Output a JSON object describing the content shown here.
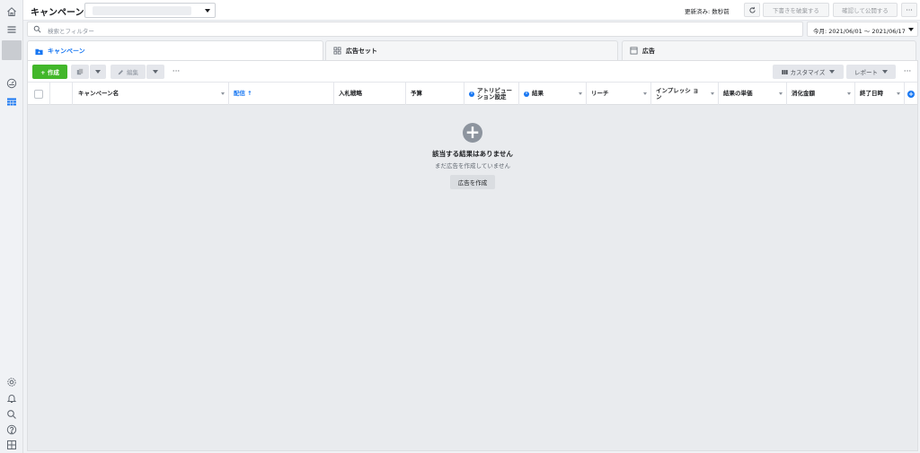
{
  "header": {
    "title": "キャンペーン",
    "updated": "更新済み: 数秒前",
    "discard_label": "下書きを破棄する",
    "publish_label": "確認して公開する",
    "more": "···"
  },
  "search": {
    "placeholder": "検索とフィルター",
    "date_range": "今月: 2021/06/01 〜 2021/06/17"
  },
  "tabs": [
    {
      "label": "キャンペーン"
    },
    {
      "label": "広告セット"
    },
    {
      "label": "広告"
    }
  ],
  "toolbar": {
    "create_label": "+ 作成",
    "edit_label": "編集",
    "more": "···",
    "customize_label": "カスタマイズ",
    "report_label": "レポート",
    "more2": "···"
  },
  "columns": {
    "name": "キャンペーン名",
    "delivery": "配信 ↑",
    "bid": "入札戦略",
    "budget": "予算",
    "attribution": "アトリビュー ション設定",
    "results": "結果",
    "reach": "リーチ",
    "impressions": "インプレッシ ョン",
    "cost_per_result": "結果の単価",
    "amount_spent": "消化金額",
    "ends": "終了日時"
  },
  "empty_state": {
    "title": "該当する結果はありません",
    "subtitle": "まだ広告を作成していません",
    "button": "広告を作成"
  },
  "colors": {
    "accent": "#1877f2",
    "create": "#42b72a"
  }
}
